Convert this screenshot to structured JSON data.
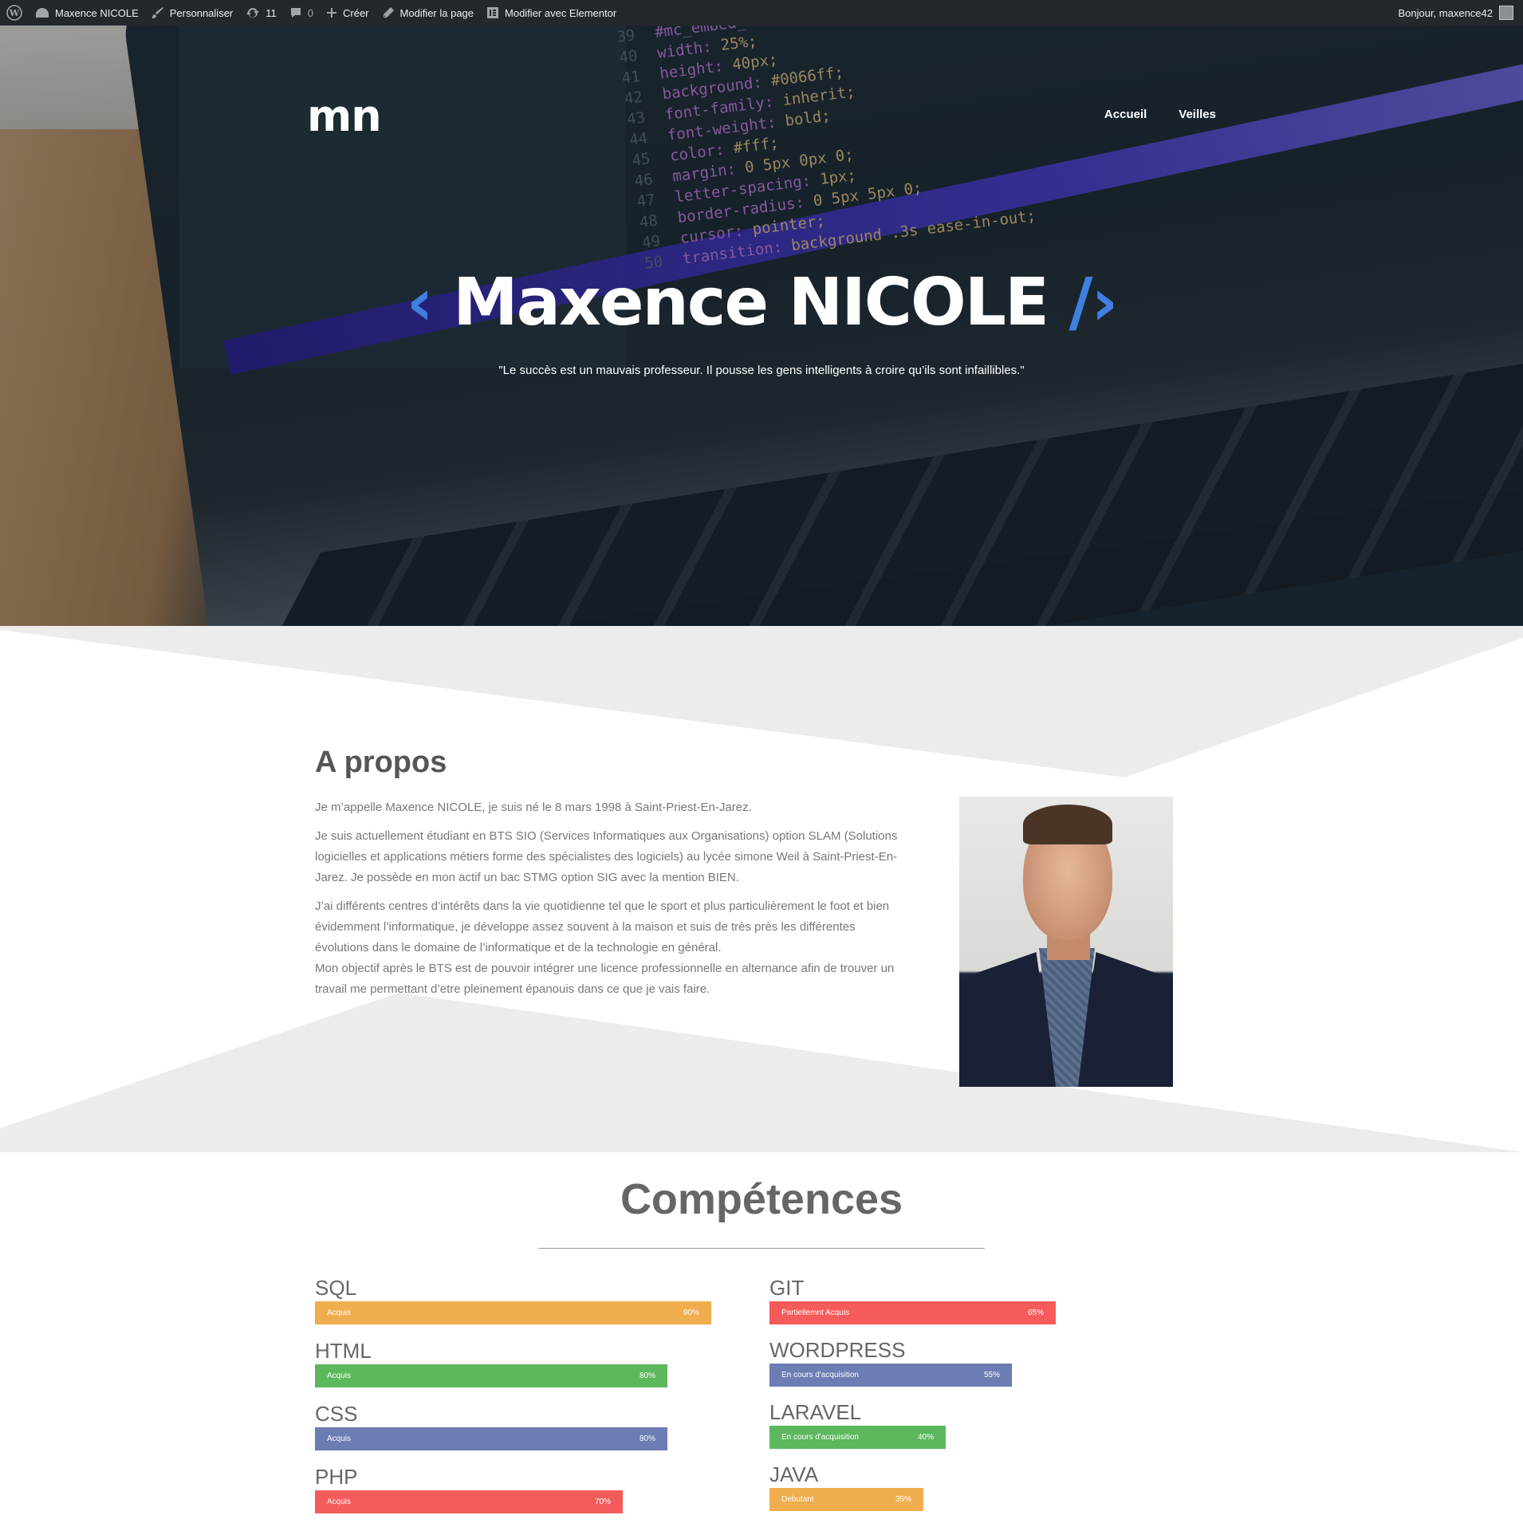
{
  "adminbar": {
    "site_name": "Maxence NICOLE",
    "customize": "Personnaliser",
    "updates_count": "11",
    "comments_count": "0",
    "new": "Créer",
    "edit_page": "Modifier la page",
    "edit_elementor": "Modifier avec Elementor",
    "greeting": "Bonjour, maxence42"
  },
  "header": {
    "logo": "mn",
    "nav": [
      "Accueil",
      "Veilles"
    ]
  },
  "hero": {
    "bracket_left": "‹",
    "name": "Maxence NICOLE",
    "bracket_right": "/›",
    "quote": "\"Le succès est un mauvais professeur. Il pousse les gens intelligents à croire qu’ils sont infaillibles.\""
  },
  "code_lines": [
    {
      "num": "39",
      "key": "#mc_embed_",
      "val": ""
    },
    {
      "num": "40",
      "key": "width: ",
      "val": "25%;"
    },
    {
      "num": "41",
      "key": "height: ",
      "val": "40px;"
    },
    {
      "num": "42",
      "key": "background: ",
      "val": "#0066ff;"
    },
    {
      "num": "43",
      "key": "font-family: ",
      "val": "inherit;"
    },
    {
      "num": "44",
      "key": "font-weight: ",
      "val": "bold;"
    },
    {
      "num": "45",
      "key": "color: ",
      "val": "#fff;"
    },
    {
      "num": "46",
      "key": "margin: ",
      "val": "0 5px 0px 0;"
    },
    {
      "num": "47",
      "key": "letter-spacing: ",
      "val": "1px;"
    },
    {
      "num": "48",
      "key": "border-radius: ",
      "val": "0 5px 5px 0;"
    },
    {
      "num": "49",
      "key": "cursor: ",
      "val": "pointer;"
    },
    {
      "num": "50",
      "key": "transition: ",
      "val": "background .3s ease-in-out;"
    }
  ],
  "about": {
    "title": "A propos",
    "p1": "Je m’appelle Maxence NICOLE, je suis né le 8 mars 1998 à Saint-Priest-En-Jarez.",
    "p2": "Je suis actuellement étudiant en BTS SIO (Services Informatiques aux Organisations) option SLAM (Solutions logicielles et applications métiers forme des spécialistes des logiciels) au lycée simone Weil à Saint-Priest-En-Jarez. Je possède en mon actif un bac STMG option SIG avec la mention BIEN.",
    "p3": "J’ai différents centres d’intérêts dans la vie quotidienne tel que le sport et plus particulièrement le foot et bien évidemment l’informatique, je développe assez souvent à la maison et suis de très près les différentes évolutions dans le domaine de l’informatique et de la technologie en général.",
    "p4": "Mon objectif après le BTS est de pouvoir intégrer une licence professionnelle en alternance afin de trouver un travail me permettant d’etre pleinement épanouis dans ce que je vais faire."
  },
  "skills": {
    "title": "Compétences",
    "left": [
      {
        "name": "SQL",
        "status": "Acquis",
        "percent": "90%",
        "value": 90,
        "color": "#f0ad4e"
      },
      {
        "name": "HTML",
        "status": "Acquis",
        "percent": "80%",
        "value": 80,
        "color": "#5cb85c"
      },
      {
        "name": "CSS",
        "status": "Acquis",
        "percent": "80%",
        "value": 80,
        "color": "#6b7db3"
      },
      {
        "name": "PHP",
        "status": "Acquis",
        "percent": "70%",
        "value": 70,
        "color": "#f55b5b"
      }
    ],
    "right": [
      {
        "name": "GIT",
        "status": "Partiellemnt Acquis",
        "percent": "65%",
        "value": 65,
        "color": "#f55b5b"
      },
      {
        "name": "WORDPRESS",
        "status": "En cours d'acquisition",
        "percent": "55%",
        "value": 55,
        "color": "#6b7db3"
      },
      {
        "name": "LARAVEL",
        "status": "En cours d'acquisition",
        "percent": "40%",
        "value": 40,
        "color": "#5cb85c"
      },
      {
        "name": "JAVA",
        "status": "Debutant",
        "percent": "35%",
        "value": 35,
        "color": "#f0ad4e"
      }
    ]
  }
}
